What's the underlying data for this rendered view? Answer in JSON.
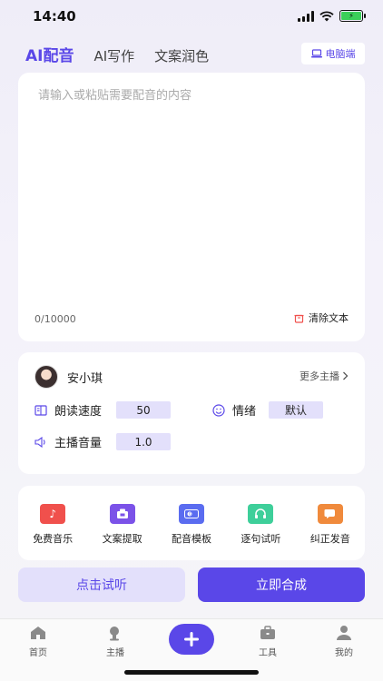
{
  "status": {
    "time": "14:40",
    "battery_level": 1.0
  },
  "tabs": [
    {
      "label": "AI配音",
      "active": true
    },
    {
      "label": "AI写作",
      "active": false
    },
    {
      "label": "文案润色",
      "active": false
    }
  ],
  "pc_button": {
    "label": "电脑端"
  },
  "editor": {
    "placeholder": "请输入或粘贴需要配音的内容",
    "value": "",
    "char_count": "0/10000",
    "clear_label": "清除文本"
  },
  "voice": {
    "speaker_name": "安小琪",
    "more_label": "更多主播",
    "speed_label": "朗读速度",
    "speed_value": "50",
    "emotion_label": "情绪",
    "emotion_value": "默认",
    "volume_label": "主播音量",
    "volume_value": "1.0"
  },
  "tools": [
    {
      "label": "免费音乐",
      "icon": "music-note-icon",
      "color": "#f0504c"
    },
    {
      "label": "文案提取",
      "icon": "extract-icon",
      "color": "#7b52e8"
    },
    {
      "label": "配音模板",
      "icon": "template-icon",
      "color": "#5a6cf0"
    },
    {
      "label": "逐句试听",
      "icon": "headphones-icon",
      "color": "#3ecf9a"
    },
    {
      "label": "纠正发音",
      "icon": "speech-bubble-icon",
      "color": "#f08a3c"
    }
  ],
  "actions": {
    "listen_label": "点击试听",
    "compose_label": "立即合成"
  },
  "nav": {
    "home": "首页",
    "anchor": "主播",
    "tools": "工具",
    "mine": "我的"
  },
  "colors": {
    "accent": "#5a47e8",
    "accent_light": "#e3e0fb"
  }
}
